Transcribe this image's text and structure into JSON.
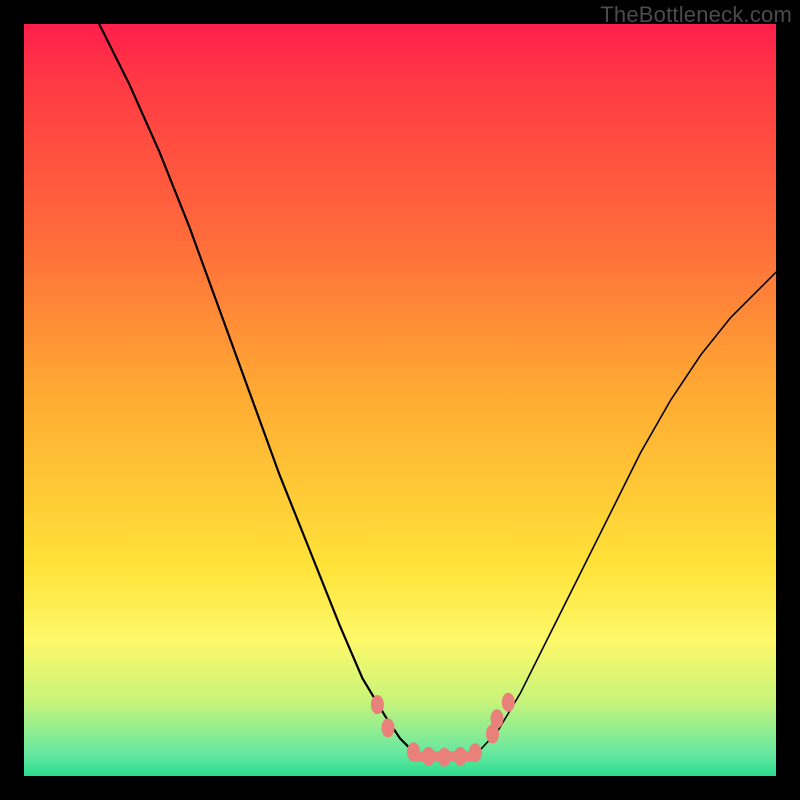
{
  "watermark": "TheBottleneck.com",
  "colors": {
    "gradient_top": "#ff1f4b",
    "gradient_mid1": "#ff6a3b",
    "gradient_mid2": "#ffe238",
    "gradient_bottom": "#2bdc8c",
    "curve": "#000000",
    "markers": "#e98079",
    "frame": "#000000"
  },
  "chart_data": {
    "type": "line",
    "title": "",
    "xlabel": "",
    "ylabel": "",
    "xlim": [
      0,
      100
    ],
    "ylim": [
      0,
      100
    ],
    "grid": false,
    "legend": false,
    "note": "Bottleneck-style V-curve. No axis ticks or numeric labels are visible in the image; x is normalized 0–100 left→right, y is normalized 0–100 where 0 = bottom (green, good) and 100 = top (red, bad). Values estimated from pixel positions.",
    "series": [
      {
        "name": "left-branch",
        "x": [
          10,
          14,
          18,
          22,
          26,
          30,
          34,
          38,
          42,
          45,
          48,
          50,
          51.5
        ],
        "y": [
          100,
          92,
          83,
          73,
          62,
          51,
          40,
          30,
          20,
          13,
          8,
          5,
          3.5
        ]
      },
      {
        "name": "valley-floor",
        "x": [
          51.5,
          53,
          55,
          57,
          59,
          60.5
        ],
        "y": [
          3.5,
          2.6,
          2.4,
          2.4,
          2.6,
          3.3
        ]
      },
      {
        "name": "right-branch",
        "x": [
          60.5,
          63,
          66,
          70,
          74,
          78,
          82,
          86,
          90,
          94,
          98,
          100
        ],
        "y": [
          3.3,
          6,
          11,
          19,
          27,
          35,
          43,
          50,
          56,
          61,
          65,
          67
        ]
      }
    ],
    "markers": [
      {
        "x": 47.0,
        "y": 9.5
      },
      {
        "x": 48.4,
        "y": 6.4
      },
      {
        "x": 51.8,
        "y": 3.2
      },
      {
        "x": 53.8,
        "y": 2.6
      },
      {
        "x": 55.9,
        "y": 2.5
      },
      {
        "x": 58.0,
        "y": 2.6
      },
      {
        "x": 60.0,
        "y": 3.1
      },
      {
        "x": 62.3,
        "y": 5.6
      },
      {
        "x": 62.9,
        "y": 7.6
      },
      {
        "x": 64.4,
        "y": 9.8
      }
    ],
    "flat_segment": {
      "x0": 51.8,
      "x1": 60.0,
      "y": 2.6
    }
  }
}
